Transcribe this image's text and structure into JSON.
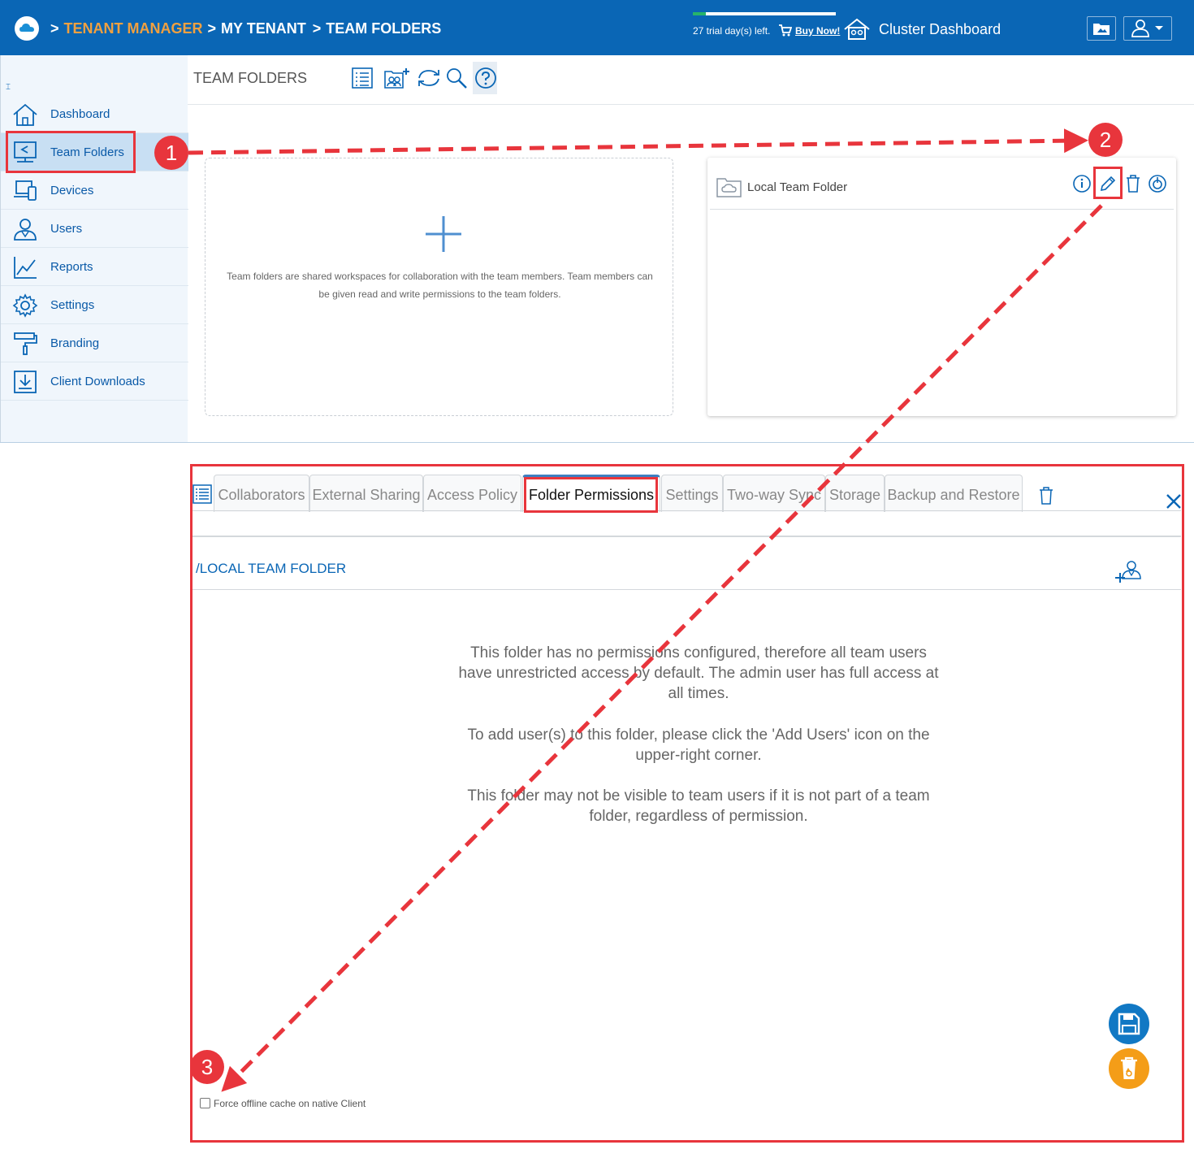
{
  "header": {
    "breadcrumb_sep": ">",
    "crumb_tenant_manager": "TENANT MANAGER",
    "crumb_my_tenant": "MY TENANT",
    "crumb_team_folders": "TEAM FOLDERS",
    "trial_text": "27 trial day(s) left.",
    "trial_progress": 0.09,
    "buy_now": "Buy Now!",
    "cluster_dashboard": "Cluster Dashboard"
  },
  "sidebar": {
    "toggle": "⌶",
    "items": [
      {
        "label": "Dashboard",
        "icon": "home-icon"
      },
      {
        "label": "Team Folders",
        "icon": "team-folders-icon",
        "active": true
      },
      {
        "label": "Devices",
        "icon": "devices-icon"
      },
      {
        "label": "Users",
        "icon": "users-icon"
      },
      {
        "label": "Reports",
        "icon": "reports-icon"
      },
      {
        "label": "Settings",
        "icon": "settings-gear-icon"
      },
      {
        "label": "Branding",
        "icon": "branding-roller-icon"
      },
      {
        "label": "Client Downloads",
        "icon": "download-icon"
      }
    ]
  },
  "main": {
    "title": "TEAM FOLDERS",
    "toolbar_icons": [
      "list-view-icon",
      "add-team-folder-icon",
      "sync-icon",
      "search-icon",
      "help-icon"
    ],
    "add_card_description": "Team folders are shared workspaces for collaboration with the team members. Team members can be given read and write permissions to the team folders.",
    "folder_card": {
      "name": "Local Team Folder",
      "actions": [
        "info-icon",
        "edit-pencil-icon",
        "delete-trash-icon",
        "backup-icon"
      ]
    }
  },
  "panel": {
    "tabs": [
      {
        "label": "Collaborators"
      },
      {
        "label": "External Sharing"
      },
      {
        "label": "Access Policy"
      },
      {
        "label": "Folder Permissions",
        "active": true
      },
      {
        "label": "Settings"
      },
      {
        "label": "Two-way Sync"
      },
      {
        "label": "Storage"
      },
      {
        "label": "Backup and Restore"
      }
    ],
    "path": "/LOCAL TEAM FOLDER",
    "message_1": "This folder has no permissions configured, therefore all team users have unrestricted access by default. The admin user has full access at all times.",
    "message_2": "To add user(s) to this folder, please click the 'Add Users' icon on the upper-right corner.",
    "message_3": "This folder may not be visible to team users if it is not part of a team folder, regardless of permission.",
    "checkbox_label": "Force offline cache on native Client",
    "checkbox_checked": false
  },
  "annotations": {
    "step1": "1",
    "step2": "2",
    "step3": "3",
    "color": "#e8353c"
  },
  "colors": {
    "brand_blue": "#0a66b5",
    "accent_orange": "#f0a040",
    "save_button": "#1178c4",
    "recycle_button": "#f49d18"
  }
}
